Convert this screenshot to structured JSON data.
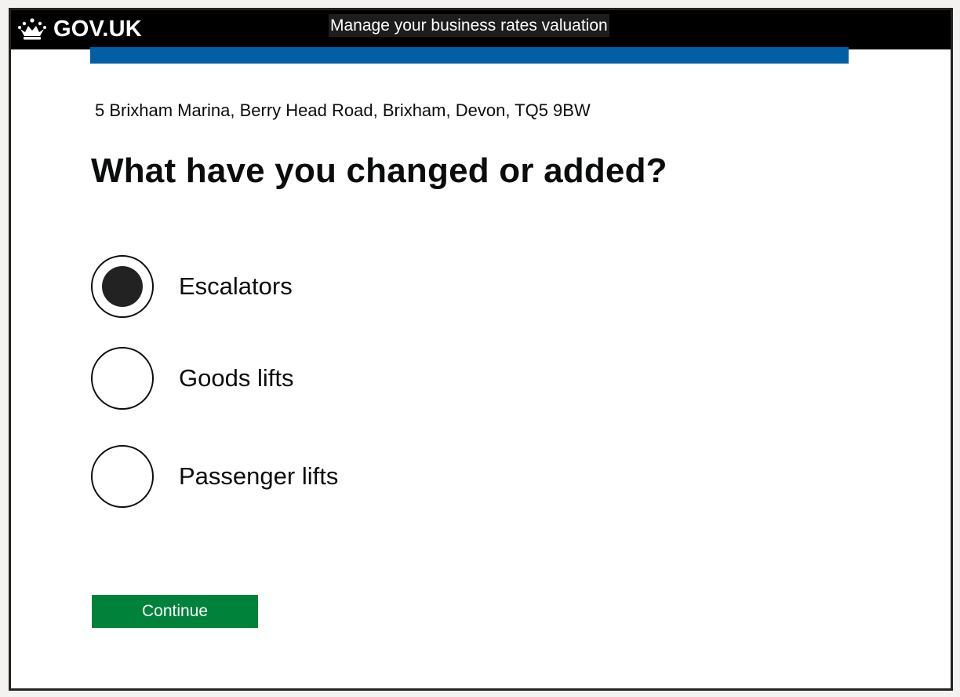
{
  "header": {
    "logo_text": "GOV.UK",
    "logo_icon": "crown-icon",
    "service_name": "Manage your business rates valuation"
  },
  "colors": {
    "header_background": "#000000",
    "accent_bar": "#005ea5",
    "button_green": "#00823b",
    "text": "#0b0c0c"
  },
  "main": {
    "address": "5 Brixham Marina, Berry Head Road, Brixham, Devon, TQ5 9BW",
    "heading": "What have you changed or added?",
    "options": [
      {
        "label": "Escalators",
        "selected": true
      },
      {
        "label": "Goods lifts",
        "selected": false
      },
      {
        "label": "Passenger lifts",
        "selected": false
      }
    ],
    "continue_label": "Continue"
  }
}
